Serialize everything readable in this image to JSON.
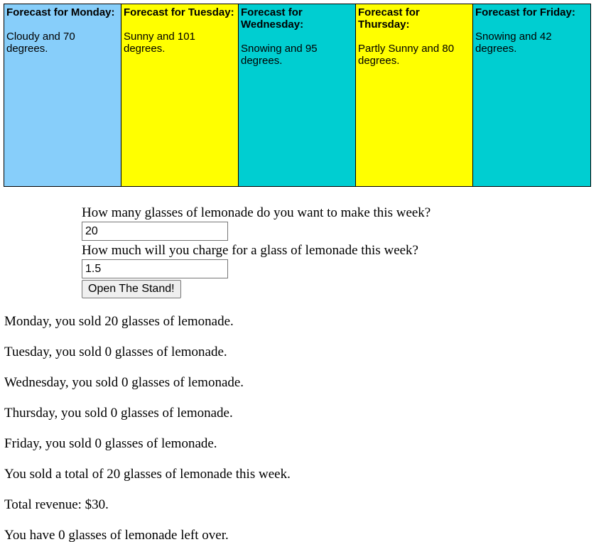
{
  "forecast": {
    "days": [
      {
        "title": "Forecast for Monday:",
        "text": "Cloudy and 70 degrees.",
        "color": "#87cefa"
      },
      {
        "title": "Forecast for Tuesday:",
        "text": "Sunny and 101 degrees.",
        "color": "#ffff00"
      },
      {
        "title": "Forecast for Wednesday:",
        "text": "Snowing and 95 degrees.",
        "color": "#00ced1"
      },
      {
        "title": "Forecast for Thursday:",
        "text": "Partly Sunny and 80 degrees.",
        "color": "#ffff00"
      },
      {
        "title": "Forecast for Friday:",
        "text": "Snowing and 42 degrees.",
        "color": "#00ced1"
      }
    ]
  },
  "form": {
    "glasses_question": "How many glasses of lemonade do you want to make this week?",
    "glasses_value": "20",
    "price_question": "How much will you charge for a glass of lemonade this week?",
    "price_value": "1.5",
    "submit_label": "Open The Stand!"
  },
  "results": {
    "lines": [
      "Monday, you sold 20 glasses of lemonade.",
      "Tuesday, you sold 0 glasses of lemonade.",
      "Wednesday, you sold 0 glasses of lemonade.",
      "Thursday, you sold 0 glasses of lemonade.",
      "Friday, you sold 0 glasses of lemonade.",
      "You sold a total of 20 glasses of lemonade this week.",
      "Total revenue: $30.",
      "You have 0 glasses of lemonade left over."
    ]
  }
}
